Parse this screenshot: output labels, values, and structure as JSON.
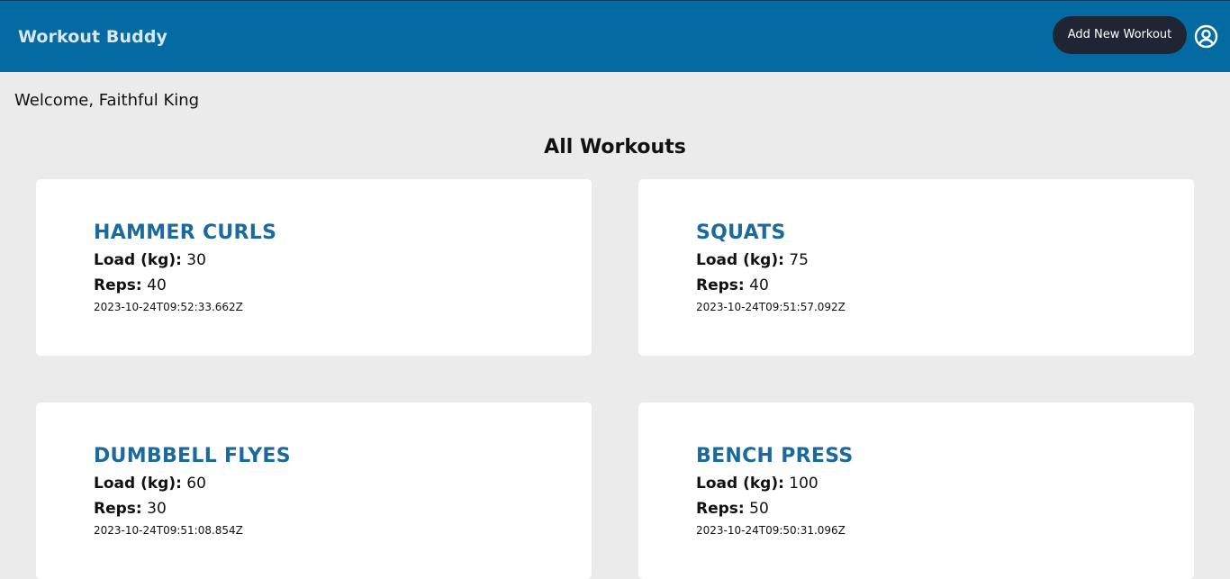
{
  "header": {
    "brand": "Workout Buddy",
    "add_button_label": "Add New Workout",
    "profile_icon": "user-circle-icon"
  },
  "welcome_text": "Welcome, Faithful King",
  "page_title": "All Workouts",
  "labels": {
    "load": "Load (kg):",
    "reps": "Reps:"
  },
  "workouts": [
    {
      "title": "HAMMER CURLS",
      "load": "30",
      "reps": "40",
      "created_at": "2023-10-24T09:52:33.662Z"
    },
    {
      "title": "SQUATS",
      "load": "75",
      "reps": "40",
      "created_at": "2023-10-24T09:51:57.092Z"
    },
    {
      "title": "DUMBBELL FLYES",
      "load": "60",
      "reps": "30",
      "created_at": "2023-10-24T09:51:08.854Z"
    },
    {
      "title": "BENCH PRESS",
      "load": "100",
      "reps": "50",
      "created_at": "2023-10-24T09:50:31.096Z"
    }
  ],
  "colors": {
    "header_bg": "#046ba2",
    "button_bg": "#1f2532",
    "page_bg": "#ebebeb",
    "card_title": "#1a6a9e"
  }
}
